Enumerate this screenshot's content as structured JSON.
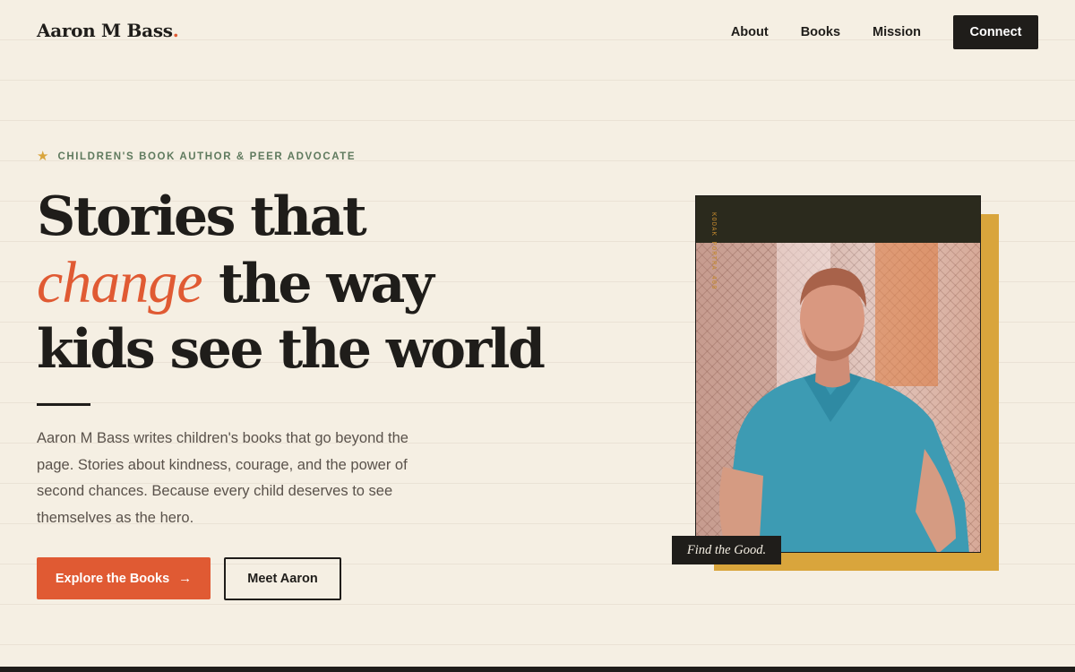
{
  "nav": {
    "logo": "Aaron M Bass",
    "logo_dot": ".",
    "links": [
      "About",
      "Books",
      "Mission"
    ],
    "cta": "Connect"
  },
  "hero": {
    "eyebrow": "CHILDREN'S BOOK AUTHOR & PEER ADVOCATE",
    "eyebrow_icon": "star-icon",
    "headline_line1": "Stories that",
    "headline_accent": "change",
    "headline_line2_rest": " the way",
    "headline_line3": "kids see the world",
    "lead": "Aaron M Bass writes children's books that go beyond the page. Stories about kindness, courage, and the power of second chances. Because every child deserves to see themselves as the hero.",
    "primary_button": "Explore the Books",
    "primary_button_icon": "arrow-right-icon",
    "secondary_button": "Meet Aaron",
    "photo_caption": "Find the Good.",
    "photo_film_text": "KODAK PORTRA 400"
  },
  "colors": {
    "background": "#f5efe3",
    "accent": "#e05a33",
    "dark": "#1f1d1a",
    "gold": "#d9a53c",
    "eyebrow": "#5f7a5e"
  }
}
